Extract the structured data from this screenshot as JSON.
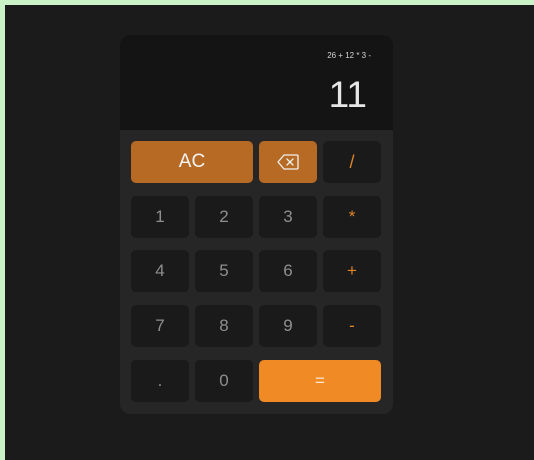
{
  "display": {
    "expression": "26 + 12 * 3 -",
    "result": "11"
  },
  "keys": {
    "clear": "AC",
    "backspace_icon": "backspace-icon",
    "divide": "/",
    "multiply": "*",
    "add": "+",
    "subtract": "-",
    "equals": "=",
    "decimal": ".",
    "d0": "0",
    "d1": "1",
    "d2": "2",
    "d3": "3",
    "d4": "4",
    "d5": "5",
    "d6": "6",
    "d7": "7",
    "d8": "8",
    "d9": "9"
  },
  "colors": {
    "accent": "#f08a24",
    "accent_muted": "#b66a24",
    "operator_text": "#e0842a",
    "key_bg": "#1a1a1a",
    "display_bg": "#141414",
    "body_bg": "#262626",
    "page_bg": "#1b1b1b",
    "frame_bg": "#c9f2c9"
  }
}
